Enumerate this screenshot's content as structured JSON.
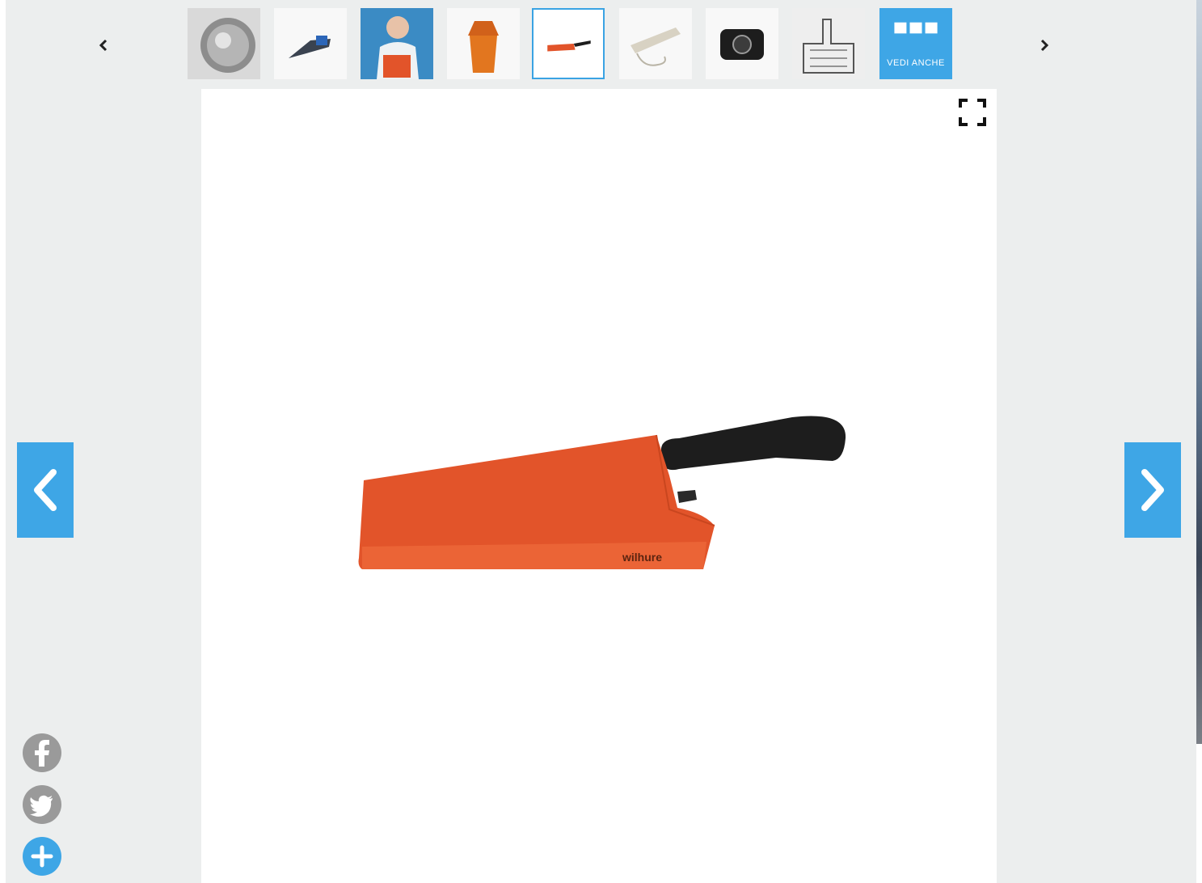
{
  "colors": {
    "accent": "#3ea6e6",
    "gallery_bg": "#eceeee",
    "product_orange": "#e2542a",
    "handle_black": "#1d1d1d",
    "share_gray": "#9a9a9a"
  },
  "thumbnail_strip": {
    "prev_icon": "chevron-left-icon",
    "next_icon": "chevron-right-icon",
    "active_index": 4,
    "thumbnails": [
      {
        "subject": "round-metal-object"
      },
      {
        "subject": "small-device"
      },
      {
        "subject": "man-with-orange-box"
      },
      {
        "subject": "orange-bin"
      },
      {
        "subject": "orange-knife-block"
      },
      {
        "subject": "power-strip"
      },
      {
        "subject": "black-camera"
      },
      {
        "subject": "machine-sketch"
      }
    ],
    "more_tile": {
      "label": "VEDI ANCHE",
      "icon": "grid-icon"
    }
  },
  "viewer": {
    "fullscreen_icon": "fullscreen-icon",
    "prev_icon": "arrow-left-icon",
    "next_icon": "arrow-right-icon",
    "product_brand_mark": "wilhure"
  },
  "share": [
    {
      "network": "facebook",
      "icon": "facebook-icon"
    },
    {
      "network": "twitter",
      "icon": "twitter-icon"
    },
    {
      "network": "more",
      "icon": "plus-icon"
    }
  ]
}
